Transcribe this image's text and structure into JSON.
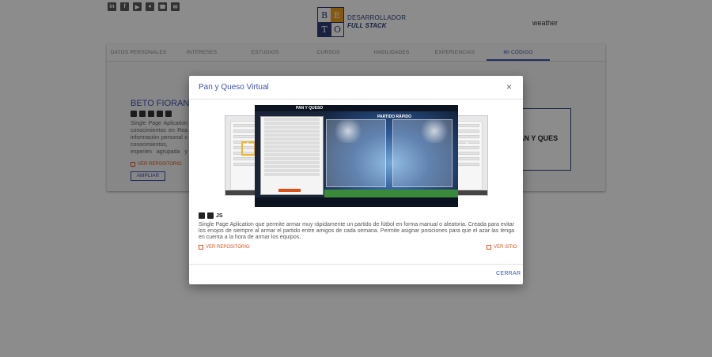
{
  "header": {
    "social_icons": [
      "linkedin-icon",
      "facebook-icon",
      "youtube-icon",
      "github-icon",
      "whatsapp-icon",
      "email-icon"
    ],
    "logo_letters": [
      "B",
      "E",
      "T",
      "O"
    ],
    "logo_line1": "DESARROLLADOR",
    "logo_line2": "FULL STACK",
    "weather": "weather"
  },
  "tabs": [
    {
      "label": "DATOS PERSONALES"
    },
    {
      "label": "INTERESES"
    },
    {
      "label": "ESTUDIOS"
    },
    {
      "label": "CURSOS"
    },
    {
      "label": "HABILIDADES"
    },
    {
      "label": "EXPERIENCIAS"
    },
    {
      "label": "MI CÓDIGO"
    }
  ],
  "background_project": {
    "title": "BETO FIORANI CV",
    "description": "Single Page Aplication conocimientos en Rea información personal c conocimientos, experien agrupada y ordenada. M amo y sueño con hacer",
    "repo_link": "VER REPOSITORIO",
    "expand_button": "AMPLIAR",
    "side_logo": "AN Y QUES"
  },
  "modal": {
    "title": "Pan y Queso Virtual",
    "close_icon": "×",
    "screenshot": {
      "logo": "PAN Y QUESO",
      "main_title": "PARTIDO RÁPIDO"
    },
    "techs_label": "JS",
    "description": "Single Page Aplication que permite armar muy rápidamente un partido de fútbol en forma manual o aleatoria. Creada para evitar los enojos de siempre al armar el partido entre amigos de cada semana. Permite asignar posiciones para que el azar las tenga en cuenta a la hora de armar los equipos.",
    "repo_link": "VER REPOSITORIO",
    "site_link": "VER SITIO",
    "close_button": "CERRAR"
  },
  "colors": {
    "primary": "#3f51b5",
    "accent": "#d9531e",
    "logo_orange": "#f4a11d",
    "logo_navy": "#2c3e75"
  }
}
